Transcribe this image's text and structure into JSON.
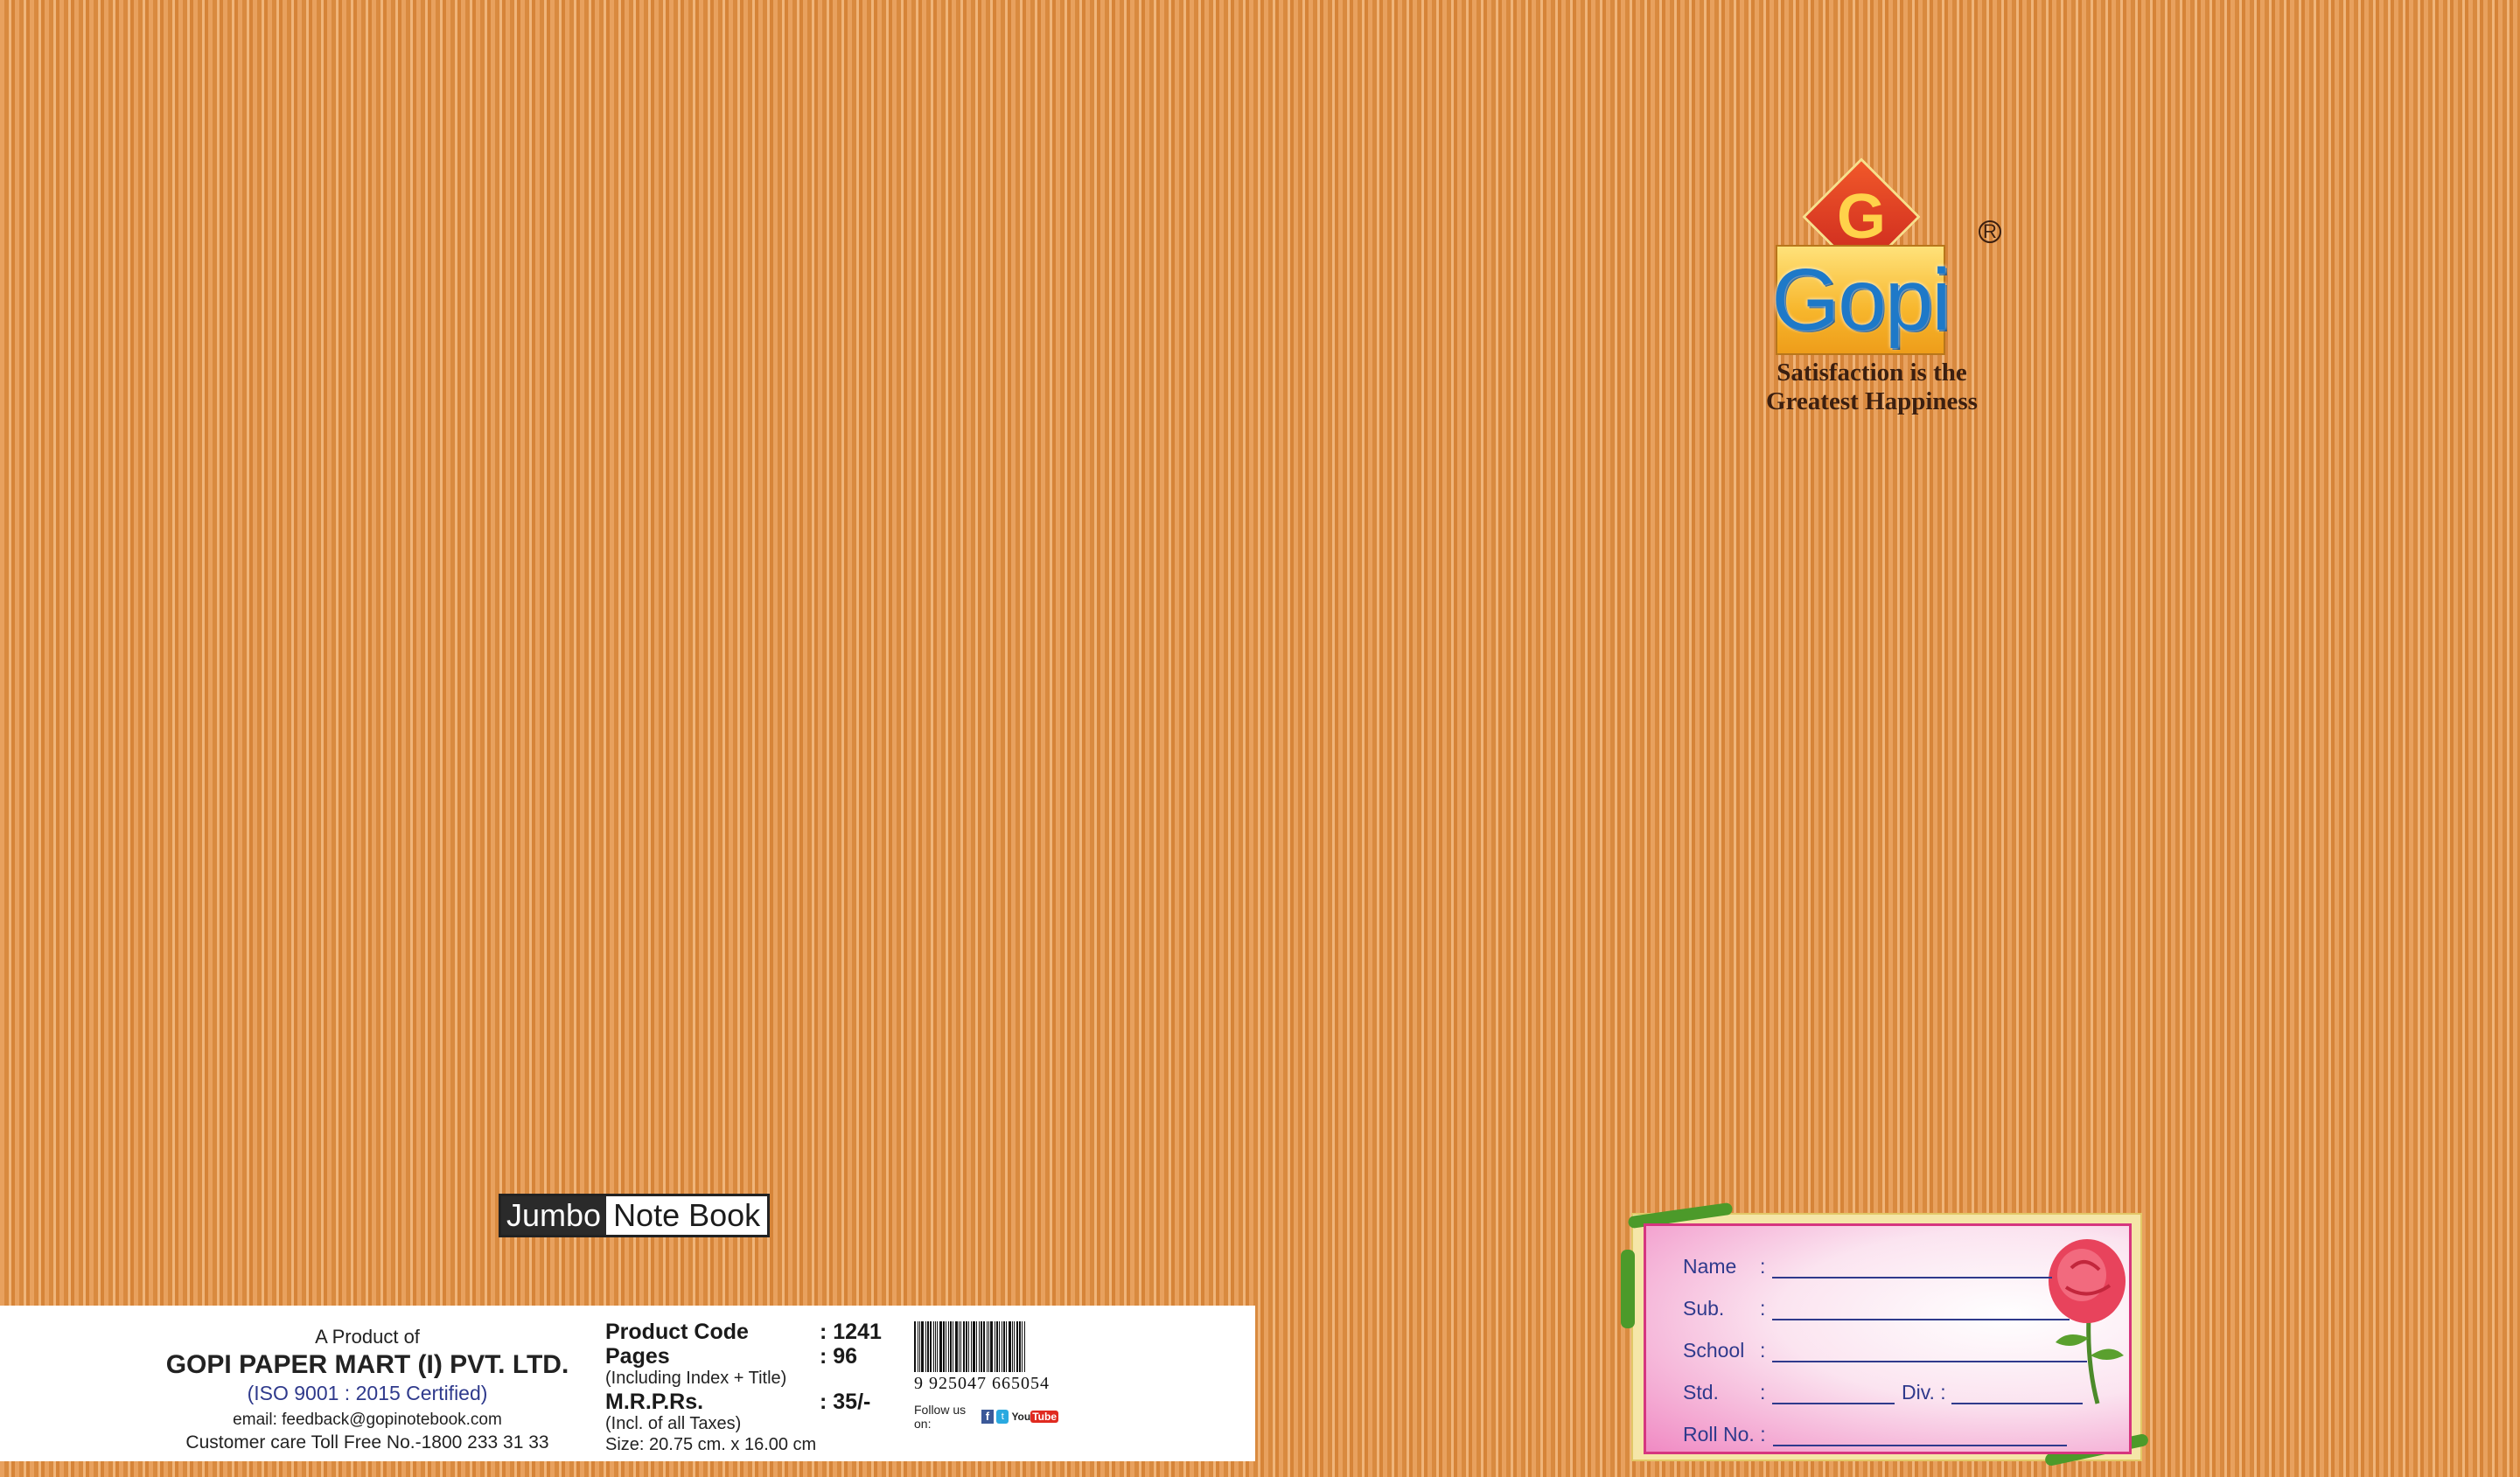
{
  "brand": {
    "logo_letter": "G",
    "logo_word": "Gopi",
    "registered_mark": "R",
    "tagline_line1": "Satisfaction is the",
    "tagline_line2": "Greatest Happiness",
    "colors": {
      "accent": "#1e79c8",
      "red": "#d22a20",
      "gold": "#f7b62c"
    }
  },
  "product_label": {
    "part1": "Jumbo",
    "part2": "Note Book"
  },
  "company": {
    "line1": "A Product of",
    "name": "GOPI PAPER MART (I) PVT. LTD.",
    "iso": "(ISO 9001 : 2015 Certified)",
    "email": "email: feedback@gopinotebook.com",
    "customer_care": "Customer care Toll Free No.-1800 233 31 33"
  },
  "specs": {
    "product_code_key": "Product Code",
    "product_code_val": ": 1241",
    "pages_key": "Pages",
    "pages_val": ": 96",
    "pages_note": "(Including Index + Title)",
    "mrp_key": "M.R.P.Rs.",
    "mrp_val": ": 35/-",
    "mrp_note": "(Incl. of all Taxes)",
    "size": "Size: 20.75 cm. x 16.00 cm"
  },
  "barcode": {
    "digits": "9 925047 665054",
    "follow_label": "Follow us on:",
    "fb": "f",
    "tw": "t",
    "yt_you": "You",
    "yt_tube": "Tube"
  },
  "name_label": {
    "name": "Name",
    "sub": "Sub.",
    "school": "School",
    "std": "Std.",
    "div": "Div. :",
    "roll": "Roll No. :",
    "colon": ":"
  }
}
